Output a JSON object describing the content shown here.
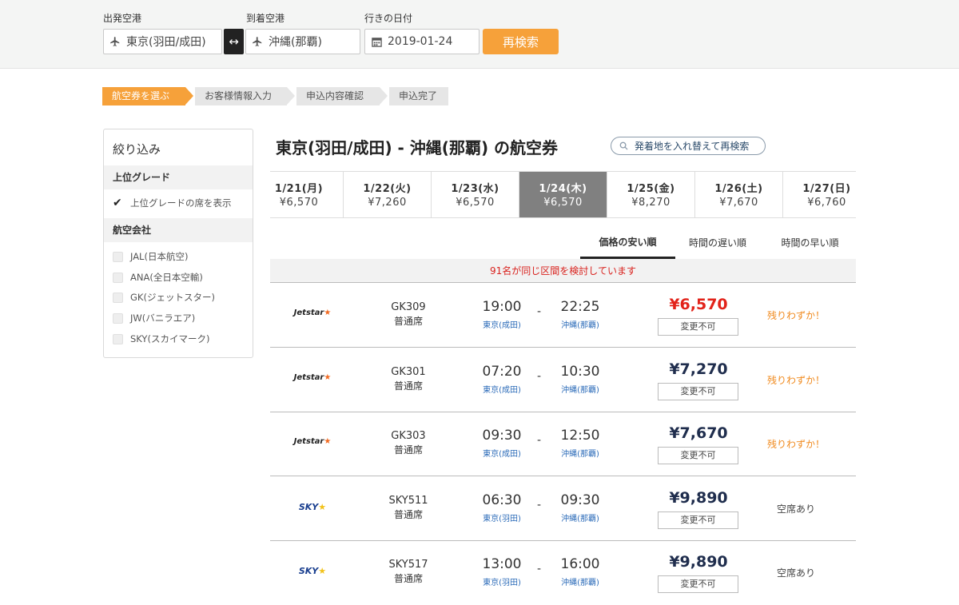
{
  "search": {
    "from_label": "出発空港",
    "to_label": "到着空港",
    "date_label": "行きの日付",
    "from_value": "東京(羽田/成田)",
    "to_value": "沖縄(那覇)",
    "date_value": "2019-01-24",
    "swap_glyph": "↔",
    "button": "再検索"
  },
  "steps": [
    "航空券を選ぶ",
    "お客様情報入力",
    "申込内容確認",
    "申込完了"
  ],
  "filter": {
    "title": "絞り込み",
    "grade_section": "上位グレード",
    "grade_option": "上位グレードの席を表示",
    "airline_section": "航空会社",
    "airlines": [
      "JAL(日本航空)",
      "ANA(全日本空輸)",
      "GK(ジェットスター)",
      "JW(バニラエア)",
      "SKY(スカイマーク)"
    ]
  },
  "heading": {
    "title": "東京(羽田/成田) - 沖縄(那覇) の航空券",
    "swap_search": "発着地を入れ替えて再検索"
  },
  "date_tabs": [
    {
      "date": "1/21(月)",
      "price": "¥6,570"
    },
    {
      "date": "1/22(火)",
      "price": "¥7,260"
    },
    {
      "date": "1/23(水)",
      "price": "¥6,570"
    },
    {
      "date": "1/24(木)",
      "price": "¥6,570",
      "selected": true
    },
    {
      "date": "1/25(金)",
      "price": "¥8,270"
    },
    {
      "date": "1/26(土)",
      "price": "¥7,670"
    },
    {
      "date": "1/27(日)",
      "price": "¥6,760"
    }
  ],
  "sort": [
    "価格の安い順",
    "時間の遅い順",
    "時間の早い順"
  ],
  "notice": "91名が同じ区間を検討しています",
  "flights": [
    {
      "airline": "Jetstar",
      "number": "GK309",
      "seat": "普通席",
      "dep": "19:00",
      "arr": "22:25",
      "dep_airport": "東京(成田)",
      "arr_airport": "沖縄(那覇)",
      "price": "¥6,570",
      "change": "変更不可",
      "status": "残りわずか！"
    },
    {
      "airline": "Jetstar",
      "number": "GK301",
      "seat": "普通席",
      "dep": "07:20",
      "arr": "10:30",
      "dep_airport": "東京(成田)",
      "arr_airport": "沖縄(那覇)",
      "price": "¥7,270",
      "change": "変更不可",
      "status": "残りわずか！"
    },
    {
      "airline": "Jetstar",
      "number": "GK303",
      "seat": "普通席",
      "dep": "09:30",
      "arr": "12:50",
      "dep_airport": "東京(成田)",
      "arr_airport": "沖縄(那覇)",
      "price": "¥7,670",
      "change": "変更不可",
      "status": "残りわずか！"
    },
    {
      "airline": "SKY",
      "number": "SKY511",
      "seat": "普通席",
      "dep": "06:30",
      "arr": "09:30",
      "dep_airport": "東京(羽田)",
      "arr_airport": "沖縄(那覇)",
      "price": "¥9,890",
      "change": "変更不可",
      "status": "空席あり"
    },
    {
      "airline": "SKY",
      "number": "SKY517",
      "seat": "普通席",
      "dep": "13:00",
      "arr": "16:00",
      "dep_airport": "東京(羽田)",
      "arr_airport": "沖縄(那覇)",
      "price": "¥9,890",
      "change": "変更不可",
      "status": "空席あり"
    }
  ],
  "colors": {
    "accent": "#f6a13a",
    "price_low": "#e2231a",
    "price": "#1f2d4d",
    "status_low": "#f08a1e",
    "link": "#2a6ab8"
  }
}
